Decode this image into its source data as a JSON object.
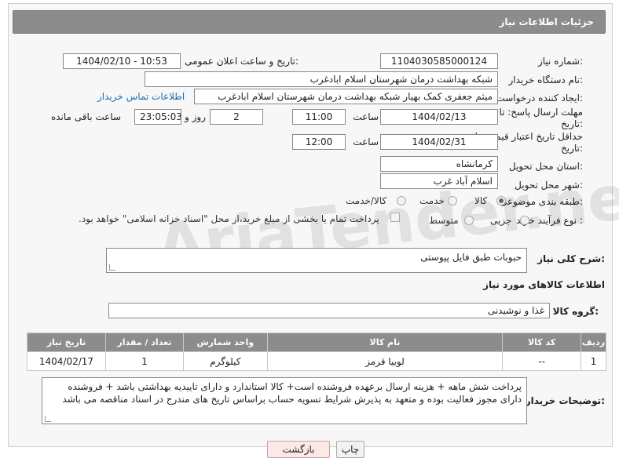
{
  "header": {
    "title": "جزئیات اطلاعات نیاز"
  },
  "fields": {
    "need_number_label": "شماره نیاز:",
    "need_number": "1104030585000124",
    "announce_label": "تاریخ و ساعت اعلان عمومی:",
    "announce_value": "1404/02/10 - 10:53",
    "buyer_org_label": "نام دستگاه خریدار:",
    "buyer_org": "شبکه بهداشت درمان شهرستان اسلام ابادغرب",
    "creator_label": "ایجاد کننده درخواست:",
    "creator": "میثم جعفری کمک بهیار شبکه بهداشت درمان شهرستان اسلام ابادغرب",
    "contact_link": "اطلاعات تماس خریدار",
    "deadline_label": "مهلت ارسال پاسخ: تا تاریخ:",
    "deadline_date": "1404/02/13",
    "time_label": "ساعت",
    "deadline_time": "11:00",
    "days_value": "2",
    "days_label": "روز و",
    "remaining_value": "23:05:03",
    "remaining_label": "ساعت باقی مانده",
    "price_validity_label": "حداقل تاریخ اعتبار قیمت: تا تاریخ:",
    "price_date": "1404/02/31",
    "price_time_label": "ساعت",
    "price_time": "12:00",
    "province_label": "استان محل تحویل:",
    "province": "کرمانشاه",
    "city_label": "شهر محل تحویل:",
    "city": "اسلام آباد غرب",
    "category_label": "طبقه بندی موضوعی:",
    "category_options": [
      "کالا",
      "خدمت",
      "کالا/خدمت"
    ],
    "process_label": "نوع فرآیند خرید :",
    "process_options": [
      "جزیی",
      "متوسط"
    ],
    "payment_note": "پرداخت تمام یا بخشی از مبلغ خرید،از محل \"اسناد خزانه اسلامی\" خواهد بود."
  },
  "description": {
    "label": "شرح کلی نیاز:",
    "value": "حبوبات طبق فایل پیوستی"
  },
  "goods_section": {
    "title": "اطلاعات کالاهای مورد نیاز",
    "group_label": "گروه کالا:",
    "group_value": "غذا و نوشیدنی"
  },
  "table": {
    "headers": [
      "ردیف",
      "کد کالا",
      "نام کالا",
      "واحد شمارش",
      "تعداد / مقدار",
      "تاریخ نیاز"
    ],
    "rows": [
      [
        "1",
        "--",
        "لوبیا قرمز",
        "کیلوگرم",
        "1",
        "1404/02/17"
      ]
    ]
  },
  "buyer_notes": {
    "label": "توضیحات خریدار:",
    "value": "پرداخت شش ماهه + هزینه ارسال برعهده فروشنده است+ کالا استاندارد و دارای تاییدیه بهداشتی باشد + فروشنده دارای مجوز فعالیت بوده و متعهد به پذیرش شرایط تسویه حساب براساس تاریخ های مندرج در اسناد مناقصه می باشد"
  },
  "buttons": {
    "print": "چاپ",
    "back": "بازگشت"
  },
  "watermark": "AriaTender.neT"
}
